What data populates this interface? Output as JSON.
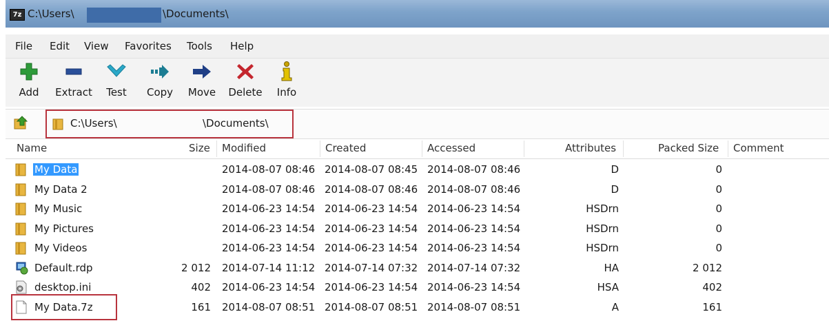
{
  "window": {
    "app_icon": "7z",
    "title_prefix": "C:\\Users\\",
    "title_suffix": "\\Documents\\"
  },
  "menu": [
    "File",
    "Edit",
    "View",
    "Favorites",
    "Tools",
    "Help"
  ],
  "toolbar": [
    {
      "label": "Add",
      "icon": "plus-icon",
      "color": "#2e9b3a"
    },
    {
      "label": "Extract",
      "icon": "minus-icon",
      "color": "#2a4f9a"
    },
    {
      "label": "Test",
      "icon": "check-chevron-icon",
      "color": "#2aa8c8"
    },
    {
      "label": "Copy",
      "icon": "copy-arrow-icon",
      "color": "#1c7d93"
    },
    {
      "label": "Move",
      "icon": "move-arrow-icon",
      "color": "#1f3f86"
    },
    {
      "label": "Delete",
      "icon": "x-icon",
      "color": "#c4262e"
    },
    {
      "label": "Info",
      "icon": "info-icon",
      "color": "#c9a400"
    }
  ],
  "path": {
    "prefix": "C:\\Users\\",
    "suffix": "\\Documents\\"
  },
  "columns": [
    "Name",
    "Size",
    "Modified",
    "Created",
    "Accessed",
    "Attributes",
    "Packed Size",
    "Comment"
  ],
  "rows": [
    {
      "name": "My Data",
      "icon": "folder-icon",
      "size": "",
      "modified": "2014-08-07 08:46",
      "created": "2014-08-07 08:45",
      "accessed": "2014-08-07 08:46",
      "attributes": "D",
      "packed": "0",
      "comment": "",
      "selected": true
    },
    {
      "name": "My Data 2",
      "icon": "folder-icon",
      "size": "",
      "modified": "2014-08-07 08:46",
      "created": "2014-08-07 08:46",
      "accessed": "2014-08-07 08:46",
      "attributes": "D",
      "packed": "0",
      "comment": ""
    },
    {
      "name": "My Music",
      "icon": "folder-icon",
      "size": "",
      "modified": "2014-06-23 14:54",
      "created": "2014-06-23 14:54",
      "accessed": "2014-06-23 14:54",
      "attributes": "HSDrn",
      "packed": "0",
      "comment": ""
    },
    {
      "name": "My Pictures",
      "icon": "folder-icon",
      "size": "",
      "modified": "2014-06-23 14:54",
      "created": "2014-06-23 14:54",
      "accessed": "2014-06-23 14:54",
      "attributes": "HSDrn",
      "packed": "0",
      "comment": ""
    },
    {
      "name": "My Videos",
      "icon": "folder-icon",
      "size": "",
      "modified": "2014-06-23 14:54",
      "created": "2014-06-23 14:54",
      "accessed": "2014-06-23 14:54",
      "attributes": "HSDrn",
      "packed": "0",
      "comment": ""
    },
    {
      "name": "Default.rdp",
      "icon": "rdp-file-icon",
      "size": "2 012",
      "modified": "2014-07-14 11:12",
      "created": "2014-07-14 07:32",
      "accessed": "2014-07-14 07:32",
      "attributes": "HA",
      "packed": "2 012",
      "comment": ""
    },
    {
      "name": "desktop.ini",
      "icon": "ini-file-icon",
      "size": "402",
      "modified": "2014-06-23 14:54",
      "created": "2014-06-23 14:54",
      "accessed": "2014-06-23 14:54",
      "attributes": "HSA",
      "packed": "402",
      "comment": ""
    },
    {
      "name": "My Data.7z",
      "icon": "blank-file-icon",
      "size": "161",
      "modified": "2014-08-07 08:51",
      "created": "2014-08-07 08:51",
      "accessed": "2014-08-07 08:51",
      "attributes": "A",
      "packed": "161",
      "comment": ""
    }
  ],
  "colors": {
    "highlight_border": "#b8333d",
    "selection": "#3399ff",
    "folder": "#e8b640"
  }
}
